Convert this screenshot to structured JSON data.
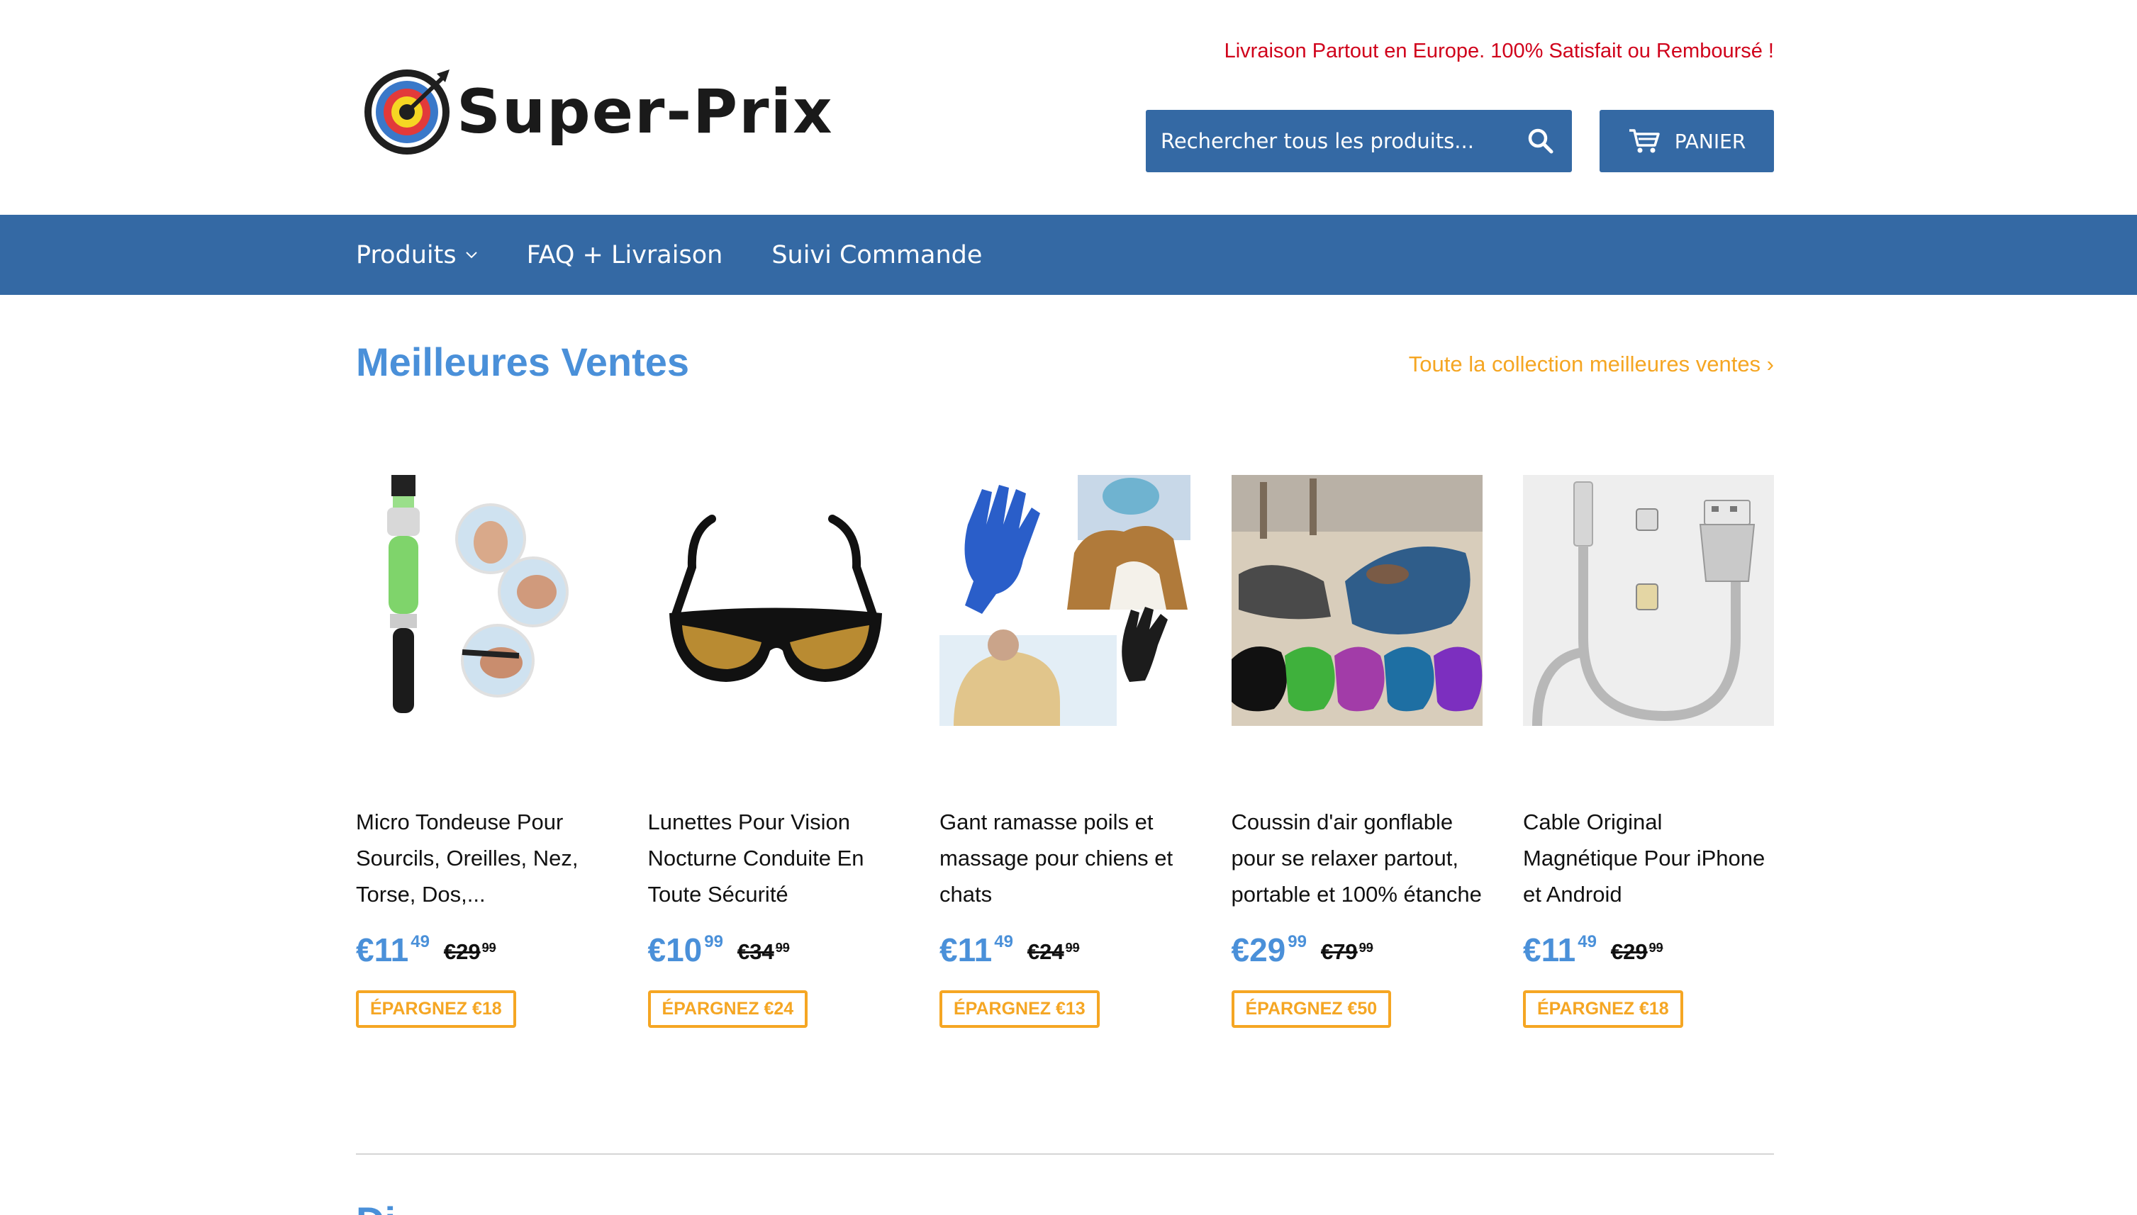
{
  "header": {
    "promo": "Livraison Partout en Europe. 100% Satisfait ou Remboursé !",
    "logo_text": "Super-Prix",
    "logo_icon": "target-arrow-icon",
    "search_placeholder": "Rechercher tous les produits...",
    "cart_label": "PANIER"
  },
  "nav": {
    "items": [
      {
        "label": "Produits",
        "has_dropdown": true
      },
      {
        "label": "FAQ + Livraison"
      },
      {
        "label": "Suivi Commande"
      }
    ]
  },
  "section": {
    "title": "Meilleures Ventes",
    "view_all": "Toute la collection meilleures ventes ›"
  },
  "products": [
    {
      "title": "Micro Tondeuse Pour Sourcils, Oreilles, Nez, Torse, Dos,...",
      "price_main": "€11",
      "price_cents": "49",
      "compare_main": "€29",
      "compare_cents": "99",
      "badge": "ÉPARGNEZ €18"
    },
    {
      "title": "Lunettes Pour Vision Nocturne Conduite En Toute Sécurité",
      "price_main": "€10",
      "price_cents": "99",
      "compare_main": "€34",
      "compare_cents": "99",
      "badge": "ÉPARGNEZ €24"
    },
    {
      "title": "Gant ramasse poils et massage pour chiens et chats",
      "price_main": "€11",
      "price_cents": "49",
      "compare_main": "€24",
      "compare_cents": "99",
      "badge": "ÉPARGNEZ €13"
    },
    {
      "title": "Coussin d'air gonflable pour se relaxer partout, portable et 100% étanche",
      "price_main": "€29",
      "price_cents": "99",
      "compare_main": "€79",
      "compare_cents": "99",
      "badge": "ÉPARGNEZ €50"
    },
    {
      "title": "Cable Original Magnétique Pour iPhone et Android",
      "price_main": "€11",
      "price_cents": "49",
      "compare_main": "€29",
      "compare_cents": "99",
      "badge": "ÉPARGNEZ €18"
    }
  ],
  "next_section": {
    "title": "Di"
  },
  "colors": {
    "brand_blue": "#3469a4",
    "accent_blue": "#4a90d9",
    "orange": "#f5a623",
    "promo_red": "#d0021b"
  }
}
